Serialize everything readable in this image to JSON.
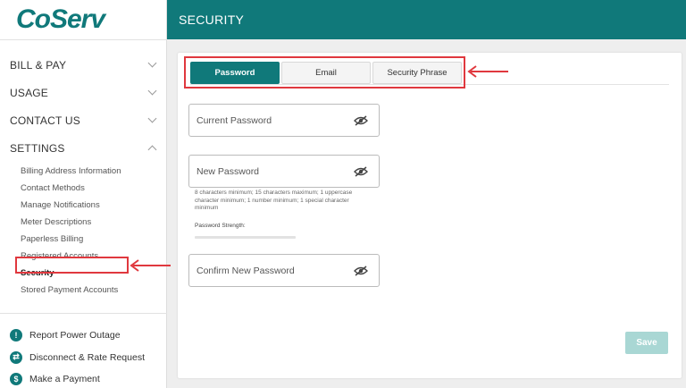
{
  "brand": {
    "logo_text": "CoServ",
    "accent": "#10797a",
    "annotation_color": "#e0383e"
  },
  "header": {
    "title": "SECURITY"
  },
  "sidebar": {
    "sections": [
      {
        "label": "BILL & PAY",
        "expanded": false
      },
      {
        "label": "USAGE",
        "expanded": false
      },
      {
        "label": "CONTACT US",
        "expanded": false
      },
      {
        "label": "SETTINGS",
        "expanded": true
      }
    ],
    "settings_items": [
      {
        "label": "Billing Address Information"
      },
      {
        "label": "Contact Methods"
      },
      {
        "label": "Manage Notifications"
      },
      {
        "label": "Meter Descriptions"
      },
      {
        "label": "Paperless Billing"
      },
      {
        "label": "Registered Accounts"
      },
      {
        "label": "Security",
        "active": true
      },
      {
        "label": "Stored Payment Accounts"
      }
    ],
    "bottom_links": [
      {
        "label": "Report Power Outage",
        "icon": "exclamation-icon",
        "glyph": "!"
      },
      {
        "label": "Disconnect & Rate Request",
        "icon": "swap-icon",
        "glyph": "⇄"
      },
      {
        "label": "Make a Payment",
        "icon": "dollar-icon",
        "glyph": "$"
      }
    ]
  },
  "tabs": [
    {
      "label": "Password",
      "active": true
    },
    {
      "label": "Email",
      "active": false
    },
    {
      "label": "Security Phrase",
      "active": false
    }
  ],
  "form": {
    "current_password_label": "Current Password",
    "new_password_label": "New Password",
    "password_help": "8 characters minimum; 15 characters maximum; 1 uppercase character minimum; 1 number minimum; 1 special character minimum",
    "strength_label": "Password Strength:",
    "confirm_password_label": "Confirm New Password",
    "save_label": "Save"
  }
}
